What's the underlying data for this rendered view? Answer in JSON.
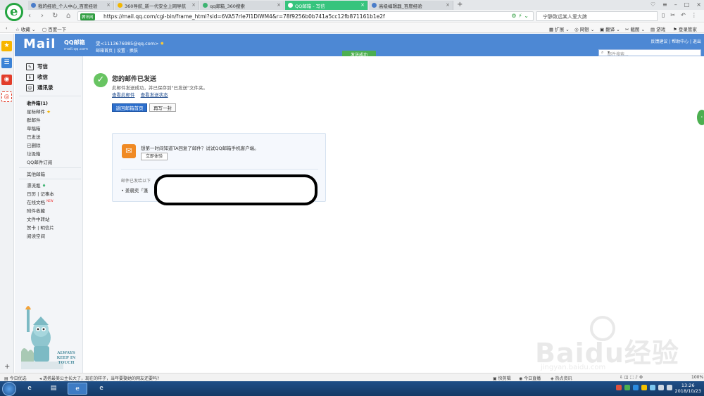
{
  "browser": {
    "tabs": [
      {
        "label": "我的经验_个人中心_百度经验"
      },
      {
        "label": "360导航_新一代安全上网导航"
      },
      {
        "label": "qq邮箱_360搜索"
      },
      {
        "label": "QQ邮箱 - 写信"
      },
      {
        "label": "高级编辑器_百度经验"
      }
    ],
    "new_tab": "+",
    "security_badge": "腾讯网",
    "url": "https://mail.qq.com/cgi-bin/frame_html?sid=6VA57rIe7l1DlWM4&r=78f9256b0b741a5cc12fb871161b1e2f",
    "search_text": "宁静致远某人爱大脾",
    "bookmarks": {
      "fav": "收藏",
      "baidu": "百度一下"
    },
    "toolbar": [
      "扩展",
      "网银",
      "翻译",
      "截图",
      "游戏",
      "登录管家"
    ]
  },
  "mail": {
    "logo": "Mail",
    "logo_sub": "QQ邮箱",
    "logo_domain": "mail.qq.com",
    "account": "雯<1113676985@qq.com>",
    "account_links": "邮箱首页 | 设置 - 换肤",
    "send_status": "发送成功",
    "top_links": "反馈建议 | 帮助中心 | 退出",
    "search_placeholder": "邮件搜索...",
    "nav": {
      "compose": "写信",
      "inbox": "收信",
      "contacts": "通讯录",
      "folders": [
        "收件箱(1)",
        "星标邮件",
        "群邮件",
        "草稿箱",
        "已发送",
        "已删除",
        "垃圾箱",
        "QQ邮件订阅"
      ],
      "other": "其他邮箱",
      "extras": [
        "漂流瓶",
        "日历 | 记事本",
        "在线文档",
        "附件收藏",
        "文件中转站",
        "贺卡 | 明信片",
        "阅读空间"
      ],
      "new_badge": "NEW"
    },
    "mascot_text": [
      "ALWAYS",
      "KEEP IN",
      "TOUCH"
    ],
    "result": {
      "title": "您的邮件已发送",
      "desc": "此邮件发送成功，并已保存到\"已发送\"文件夹。",
      "link_view": "查看此邮件",
      "link_status": "查看发送状态",
      "btn_home": "返回邮箱首页",
      "btn_again": "再写一封"
    },
    "promo": {
      "text": "想第一时间知道TA回复了邮件？试试QQ邮箱手机客户端。",
      "btn": "立即体验",
      "addr_note": "邮件已发给以下",
      "addr_entry": "• 姜晨奕「蓬"
    }
  },
  "watermark": {
    "text": "Baidu经验",
    "sub": "jingyan.baidu.com"
  },
  "statusbar": {
    "left1": "今日优选",
    "left2": "透搭最美公主长大了，现在的样子，当年要娶她的网友还要吗?",
    "items": [
      "快剪辑",
      "今日直播",
      "热点资讯"
    ],
    "zoom": "100%"
  },
  "taskbar": {
    "time": "13:26",
    "date": "2018/10/23"
  }
}
